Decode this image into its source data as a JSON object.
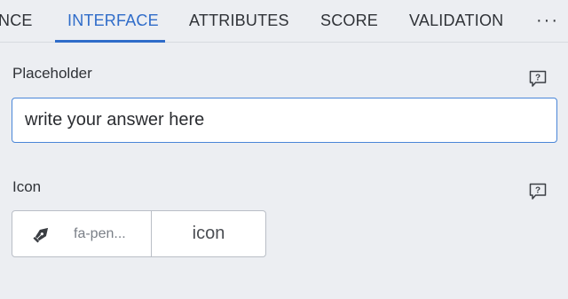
{
  "tabs": [
    {
      "label": "NCE",
      "active": false
    },
    {
      "label": "INTERFACE",
      "active": true
    },
    {
      "label": "ATTRIBUTES",
      "active": false
    },
    {
      "label": "SCORE",
      "active": false
    },
    {
      "label": "VALIDATION",
      "active": false
    }
  ],
  "more_label": "···",
  "placeholder_field": {
    "label": "Placeholder",
    "value": "write your answer here",
    "help_icon": "help-bubble-icon"
  },
  "icon_field": {
    "label": "Icon",
    "icon_name": "pen-nib-icon",
    "icon_value": "fa-pen...",
    "text_value": "icon",
    "help_icon": "help-bubble-icon"
  },
  "colors": {
    "accent": "#2f6cc9",
    "background": "#eceef2",
    "input_border_focused": "#4a86d8"
  }
}
